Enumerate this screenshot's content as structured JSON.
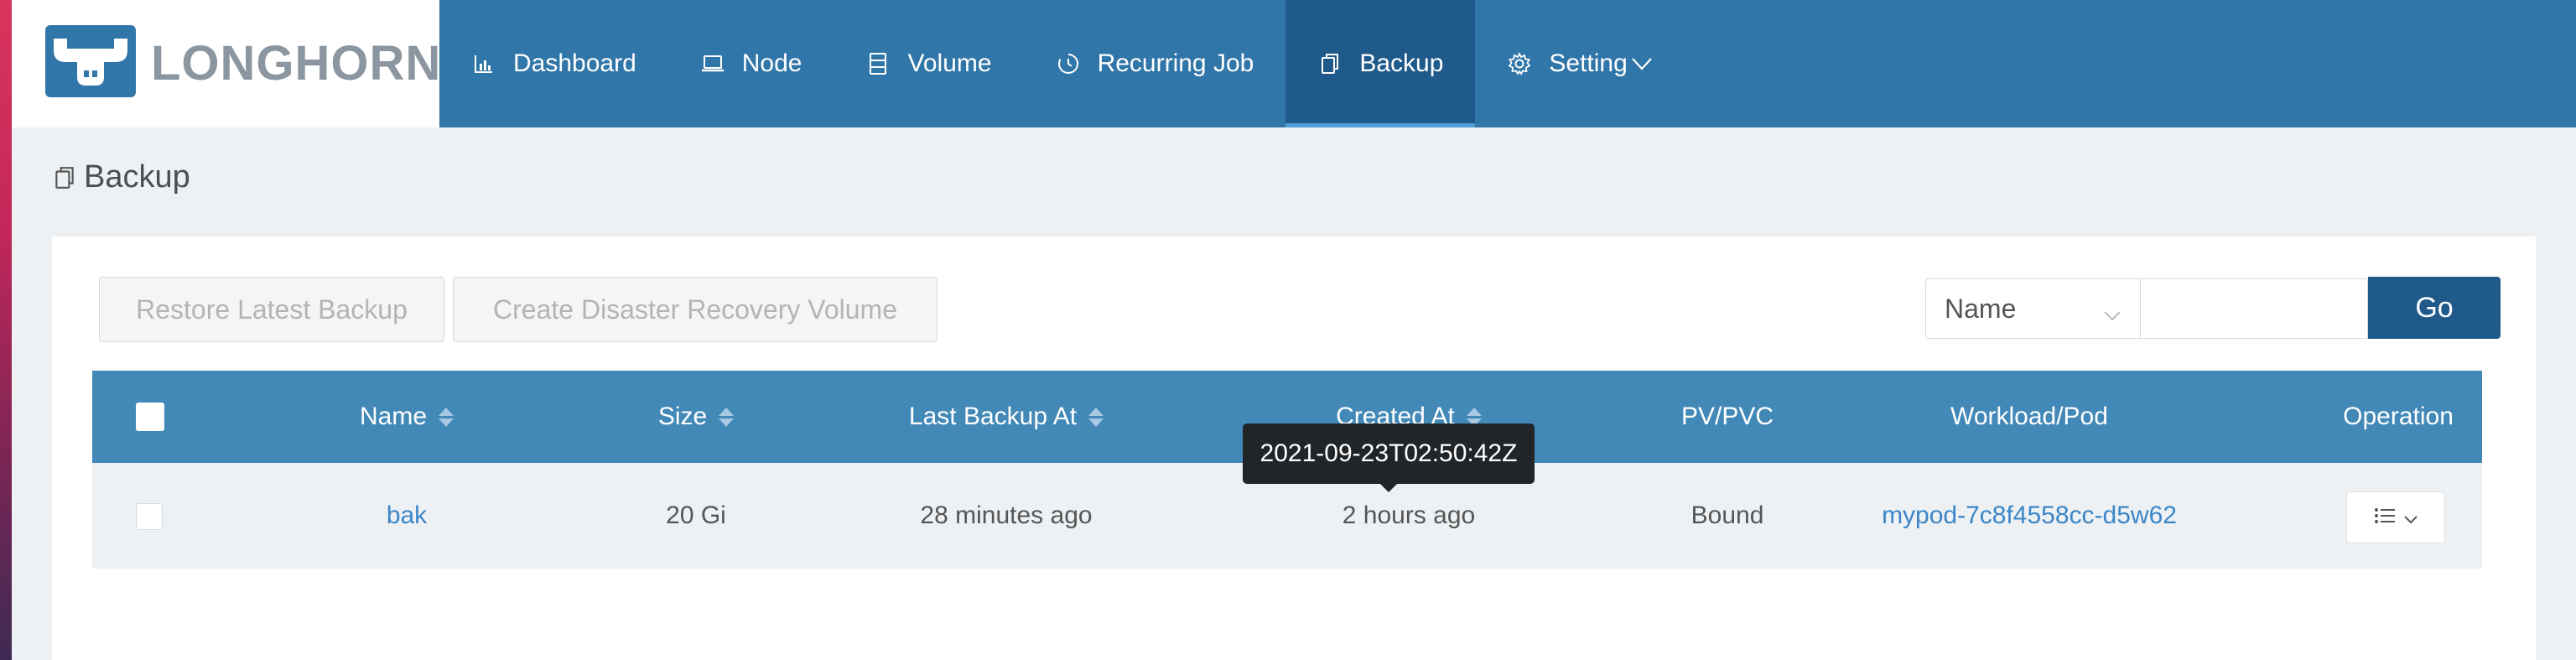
{
  "brand": {
    "name": "LONGHORN"
  },
  "nav": {
    "items": [
      {
        "label": "Dashboard",
        "icon": "bar-chart-icon"
      },
      {
        "label": "Node",
        "icon": "laptop-icon"
      },
      {
        "label": "Volume",
        "icon": "database-icon"
      },
      {
        "label": "Recurring Job",
        "icon": "clock-icon"
      },
      {
        "label": "Backup",
        "icon": "copy-icon",
        "active": true
      },
      {
        "label": "Setting",
        "icon": "gear-icon"
      }
    ]
  },
  "page": {
    "title": "Backup"
  },
  "toolbar": {
    "restore_label": "Restore Latest Backup",
    "drv_label": "Create Disaster Recovery Volume",
    "search_field": "Name",
    "search_value": "",
    "go_label": "Go"
  },
  "table": {
    "columns": [
      "Name",
      "Size",
      "Last Backup At",
      "Created At",
      "PV/PVC",
      "Workload/Pod",
      "Operation"
    ],
    "rows": [
      {
        "name": "bak",
        "size": "20 Gi",
        "last_backup_at": "28 minutes ago",
        "created_at": "2 hours ago",
        "pv_pvc": "Bound",
        "workload_pod": "mypod-7c8f4558cc-d5w62"
      }
    ]
  },
  "tooltip": {
    "text": "2021-09-23T02:50:42Z"
  },
  "colors": {
    "header": "#3176a8",
    "active_nav": "#1f5a8b",
    "table_header": "#4389b8",
    "link": "#3b86c7"
  }
}
